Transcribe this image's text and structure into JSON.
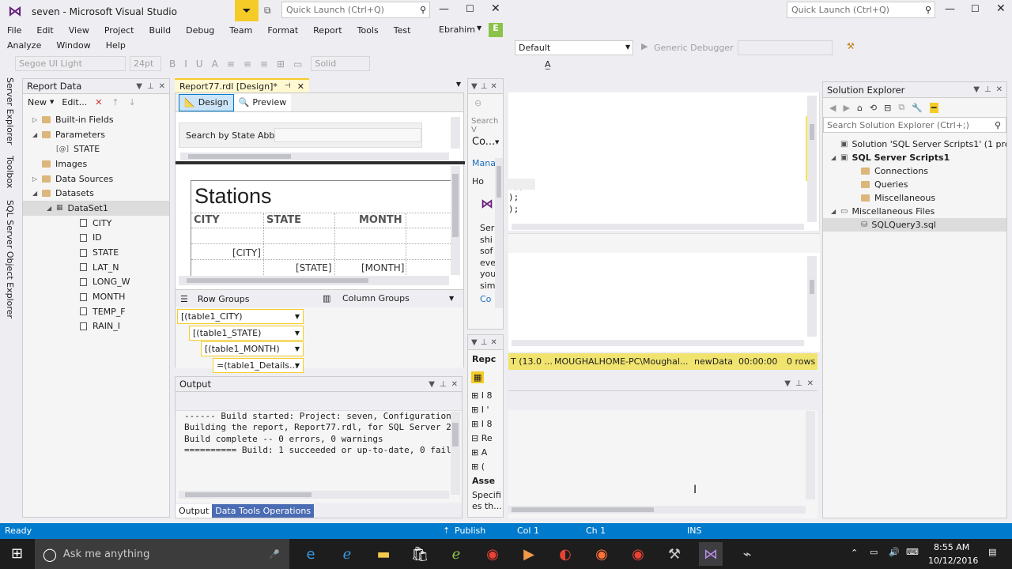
{
  "titlebar": {
    "title": "seven - Microsoft Visual Studio",
    "quick_launch": "Quick Launch (Ctrl+Q)",
    "quick_launch_right": "Quick Launch (Ctrl+Q)"
  },
  "menu": {
    "row1": [
      "File",
      "Edit",
      "View",
      "Project",
      "Build",
      "Debug",
      "Team",
      "Format",
      "Report",
      "Tools",
      "Test"
    ],
    "row2": [
      "Analyze",
      "Window",
      "Help"
    ],
    "user": "Ebrahim",
    "user_initial": "E"
  },
  "toolbar": {
    "font": "Segoe UI Light",
    "size": "24pt",
    "border": "Solid",
    "config": "Default",
    "debugger": "Generic Debugger"
  },
  "report_data": {
    "title": "Report Data",
    "new": "New",
    "edit": "Edit...",
    "items": [
      {
        "label": "Built-in Fields",
        "level": 0,
        "exp": "▷",
        "icon": "folder"
      },
      {
        "label": "Parameters",
        "level": 0,
        "exp": "◢",
        "icon": "folder"
      },
      {
        "label": "STATE",
        "level": 1,
        "exp": "",
        "icon": "param"
      },
      {
        "label": "Images",
        "level": 0,
        "exp": "",
        "icon": "folder"
      },
      {
        "label": "Data Sources",
        "level": 0,
        "exp": "▷",
        "icon": "folder"
      },
      {
        "label": "Datasets",
        "level": 0,
        "exp": "◢",
        "icon": "folder"
      },
      {
        "label": "DataSet1",
        "level": 1,
        "exp": "◢",
        "icon": "dataset",
        "selected": true
      },
      {
        "label": "CITY",
        "level": 2,
        "exp": "",
        "icon": "field"
      },
      {
        "label": "ID",
        "level": 2,
        "exp": "",
        "icon": "field"
      },
      {
        "label": "STATE",
        "level": 2,
        "exp": "",
        "icon": "field"
      },
      {
        "label": "LAT_N",
        "level": 2,
        "exp": "",
        "icon": "field"
      },
      {
        "label": "LONG_W",
        "level": 2,
        "exp": "",
        "icon": "field"
      },
      {
        "label": "MONTH",
        "level": 2,
        "exp": "",
        "icon": "field"
      },
      {
        "label": "TEMP_F",
        "level": 2,
        "exp": "",
        "icon": "field"
      },
      {
        "label": "RAIN_I",
        "level": 2,
        "exp": "",
        "icon": "field"
      }
    ]
  },
  "side_tabs": [
    "Server Explorer",
    "Toolbox",
    "SQL Server Object Explorer"
  ],
  "report_tab": {
    "label": "Report77.rdl [Design]*",
    "design": "Design",
    "preview": "Preview",
    "param_label": "Search by State Abb."
  },
  "report": {
    "title": "Stations",
    "headers": [
      "CITY",
      "STATE",
      "MONTH"
    ],
    "city": "[CITY]",
    "state": "[STATE]",
    "month": "[MONTH]"
  },
  "groups": {
    "row": "Row Groups",
    "col": "Column Groups",
    "items": [
      "(table1_CITY)",
      "(table1_STATE)",
      "(table1_MONTH)",
      "(table1_Details..."
    ]
  },
  "output": {
    "title": "Output",
    "lines": [
      "------ Build started: Project: seven, Configuration",
      "Building the report, Report77.rdl, for SQL Server 2",
      "Build complete -- 0 errors, 0 warnings",
      "========== Build: 1 succeeded or up-to-date, 0 fail"
    ],
    "tab1": "Output",
    "tab2": "Data Tools Operations"
  },
  "mid_panel": {
    "search": "Search V",
    "combo": "Co...",
    "manage": "Mana",
    "ho": "Ho",
    "lines": [
      "Ser",
      "shi",
      "sof",
      "eve",
      "you",
      "sim"
    ],
    "co": "Co"
  },
  "mid_panel2": {
    "title": "Repc",
    "rows": [
      "I 8",
      "I '",
      "I 8",
      "Re",
      "A",
      "("
    ],
    "asse": "Asse",
    "spec": "Specifi",
    "spec2": "es th..."
  },
  "sql": {
    "lines": [
      "2);",
      ");",
      ");"
    ],
    "status": [
      "T (13.0 ...",
      "MOUGHALHOME-PC\\Moughal...",
      "newData",
      "00:00:00",
      "0 rows"
    ]
  },
  "solution": {
    "title": "Solution Explorer",
    "search": "Search Solution Explorer (Ctrl+;)",
    "items": [
      {
        "label": "Solution 'SQL Server Scripts1' (1 project)",
        "level": 0,
        "exp": "",
        "bold": false
      },
      {
        "label": "SQL Server Scripts1",
        "level": 0,
        "exp": "◢",
        "bold": true
      },
      {
        "label": "Connections",
        "level": 1,
        "exp": "",
        "bold": false
      },
      {
        "label": "Queries",
        "level": 1,
        "exp": "",
        "bold": false
      },
      {
        "label": "Miscellaneous",
        "level": 1,
        "exp": "",
        "bold": false
      },
      {
        "label": "Miscellaneous Files",
        "level": 0,
        "exp": "◢",
        "bold": false
      },
      {
        "label": "SQLQuery3.sql",
        "level": 1,
        "exp": "",
        "bold": false,
        "selected": true
      }
    ]
  },
  "statusbar": {
    "ready": "Ready",
    "publish": "Publish",
    "col": "Col 1",
    "ch": "Ch 1",
    "ins": "INS"
  },
  "taskbar": {
    "search": "Ask me anything",
    "time": "8:55 AM",
    "date": "10/12/2016"
  }
}
